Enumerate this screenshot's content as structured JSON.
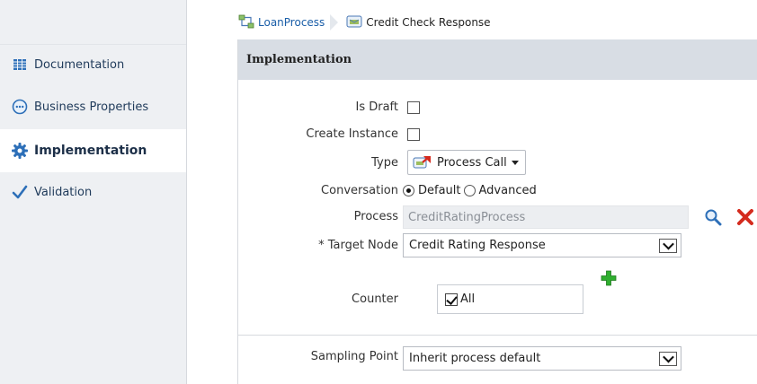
{
  "breadcrumb": {
    "items": [
      {
        "label": "LoanProcess",
        "icon": "process-flow-icon"
      },
      {
        "label": "Credit Check Response",
        "icon": "activity-icon"
      }
    ]
  },
  "sidebar": {
    "items": [
      {
        "label": "Documentation",
        "icon": "documentation-icon",
        "active": false
      },
      {
        "label": "Business Properties",
        "icon": "business-properties-icon",
        "active": false
      },
      {
        "label": "Implementation",
        "icon": "gear-icon",
        "active": true
      },
      {
        "label": "Validation",
        "icon": "checkmark-icon",
        "active": false
      }
    ]
  },
  "section": {
    "title": "Implementation"
  },
  "form": {
    "is_draft": {
      "label": "Is Draft",
      "checked": false
    },
    "create_instance": {
      "label": "Create Instance",
      "checked": false
    },
    "type": {
      "label": "Type",
      "value": "Process Call"
    },
    "conversation": {
      "label": "Conversation",
      "options": [
        "Default",
        "Advanced"
      ],
      "selected": "Default"
    },
    "process": {
      "label": "Process",
      "value": "CreditRatingProcess"
    },
    "target_node": {
      "label": "* Target Node",
      "value": "Credit Rating Response"
    },
    "counter": {
      "label": "Counter",
      "checkbox_label": "All",
      "checked": true
    },
    "sampling_point": {
      "label": "Sampling Point",
      "value": "Inherit process default"
    }
  },
  "colors": {
    "sidebar_bg": "#eef0f3",
    "header_bg": "#d8dde4",
    "link": "#1a5ea8",
    "add_green": "#2fae2f",
    "delete_red": "#d42b1e"
  }
}
